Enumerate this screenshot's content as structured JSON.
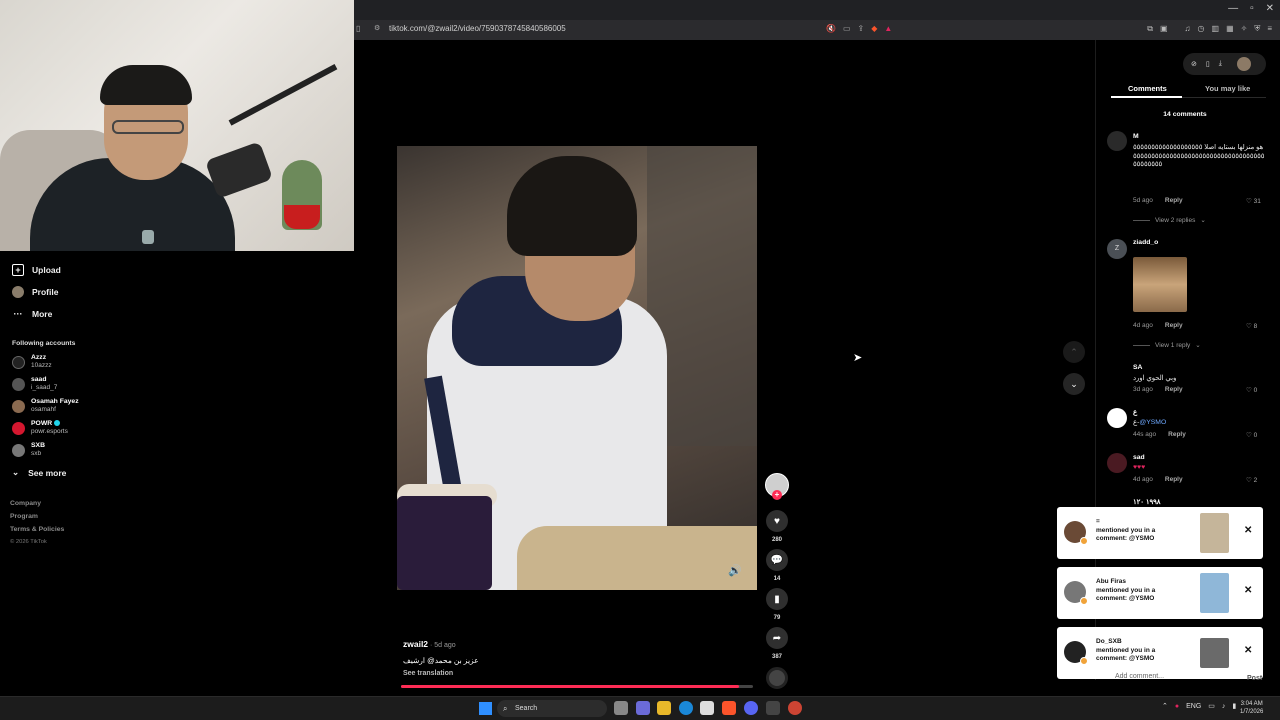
{
  "browser": {
    "url": "tiktok.com/@zwail2/video/7590378745840586005"
  },
  "sidebar": {
    "nav": [
      {
        "label": "Upload"
      },
      {
        "label": "Profile"
      },
      {
        "label": "More"
      }
    ],
    "following_title": "Following accounts",
    "accounts": [
      {
        "name": "Azzz",
        "handle": "10azzz"
      },
      {
        "name": "saad",
        "handle": "i_saad_7"
      },
      {
        "name": "Osamah Fayez",
        "handle": "osamahf"
      },
      {
        "name": "POWR",
        "handle": "powr.esports",
        "verified": true
      },
      {
        "name": "SXB",
        "handle": "sxb"
      }
    ],
    "see_more": "See more",
    "footer": [
      "Company",
      "Program",
      "Terms & Policies"
    ],
    "copyright": "© 2026 TikTok"
  },
  "video": {
    "author": "zwail2",
    "time": " · 5d ago",
    "caption": "عزيز بن محمد@ ارشيف",
    "see_translation": "See translation",
    "progress_fraction": 0.96,
    "likes": "280",
    "comments": "14",
    "saves": "79",
    "shares": "387"
  },
  "panel": {
    "tabs": [
      "Comments",
      "You may like"
    ],
    "comments_count": "14 comments",
    "comments": [
      {
        "user": "M",
        "text": "هو منزلها بستايه اصلا ٥٥٥٥٥٥٥٥٥٥٥٥٥٥٥٥٥٥٥٥٥٥٥٥٥٥٥٥٥٥٥٥٥٥٥٥٥٥٥٥٥٥٥٥٥٥٥٥٥٥٥٥٥٥٥٥٥٥٥٥٥٥٥",
        "time": "5d ago",
        "reply": "Reply",
        "likes": "31",
        "view_replies": "View 2 replies"
      },
      {
        "user": "ziadd_o",
        "avatar_letter": "Z",
        "time": "4d ago",
        "reply": "Reply",
        "likes": "8",
        "view_replies": "View 1 reply"
      },
      {
        "user": "SA",
        "text": "وبي الحوي اورد",
        "time": "3d ago",
        "reply": "Reply",
        "likes": "0"
      },
      {
        "user": "ع",
        "text_prefix": "ع-",
        "mention": "@YSMO",
        "time": "44s ago",
        "reply": "Reply",
        "likes": "0"
      },
      {
        "user": "sad",
        "text": "♥♥♥",
        "time": "4d ago",
        "reply": "Reply",
        "likes": "2"
      },
      {
        "user": "١٩٩٨ ١٢٠",
        "time": ""
      }
    ],
    "comment_placeholder": "Add comment...",
    "post_label": "Post"
  },
  "notifications": [
    {
      "user": "=",
      "text": "mentioned you in a comment: @YSMO"
    },
    {
      "user": "Abu Firas",
      "text": "mentioned you in a comment: @YSMO"
    },
    {
      "user": "Do_SXB",
      "text": "mentioned you in a comment: @YSMO"
    }
  ],
  "taskbar": {
    "search_label": "Search",
    "lang": "ENG",
    "time": "3:04 AM",
    "date": "1/7/2026"
  }
}
